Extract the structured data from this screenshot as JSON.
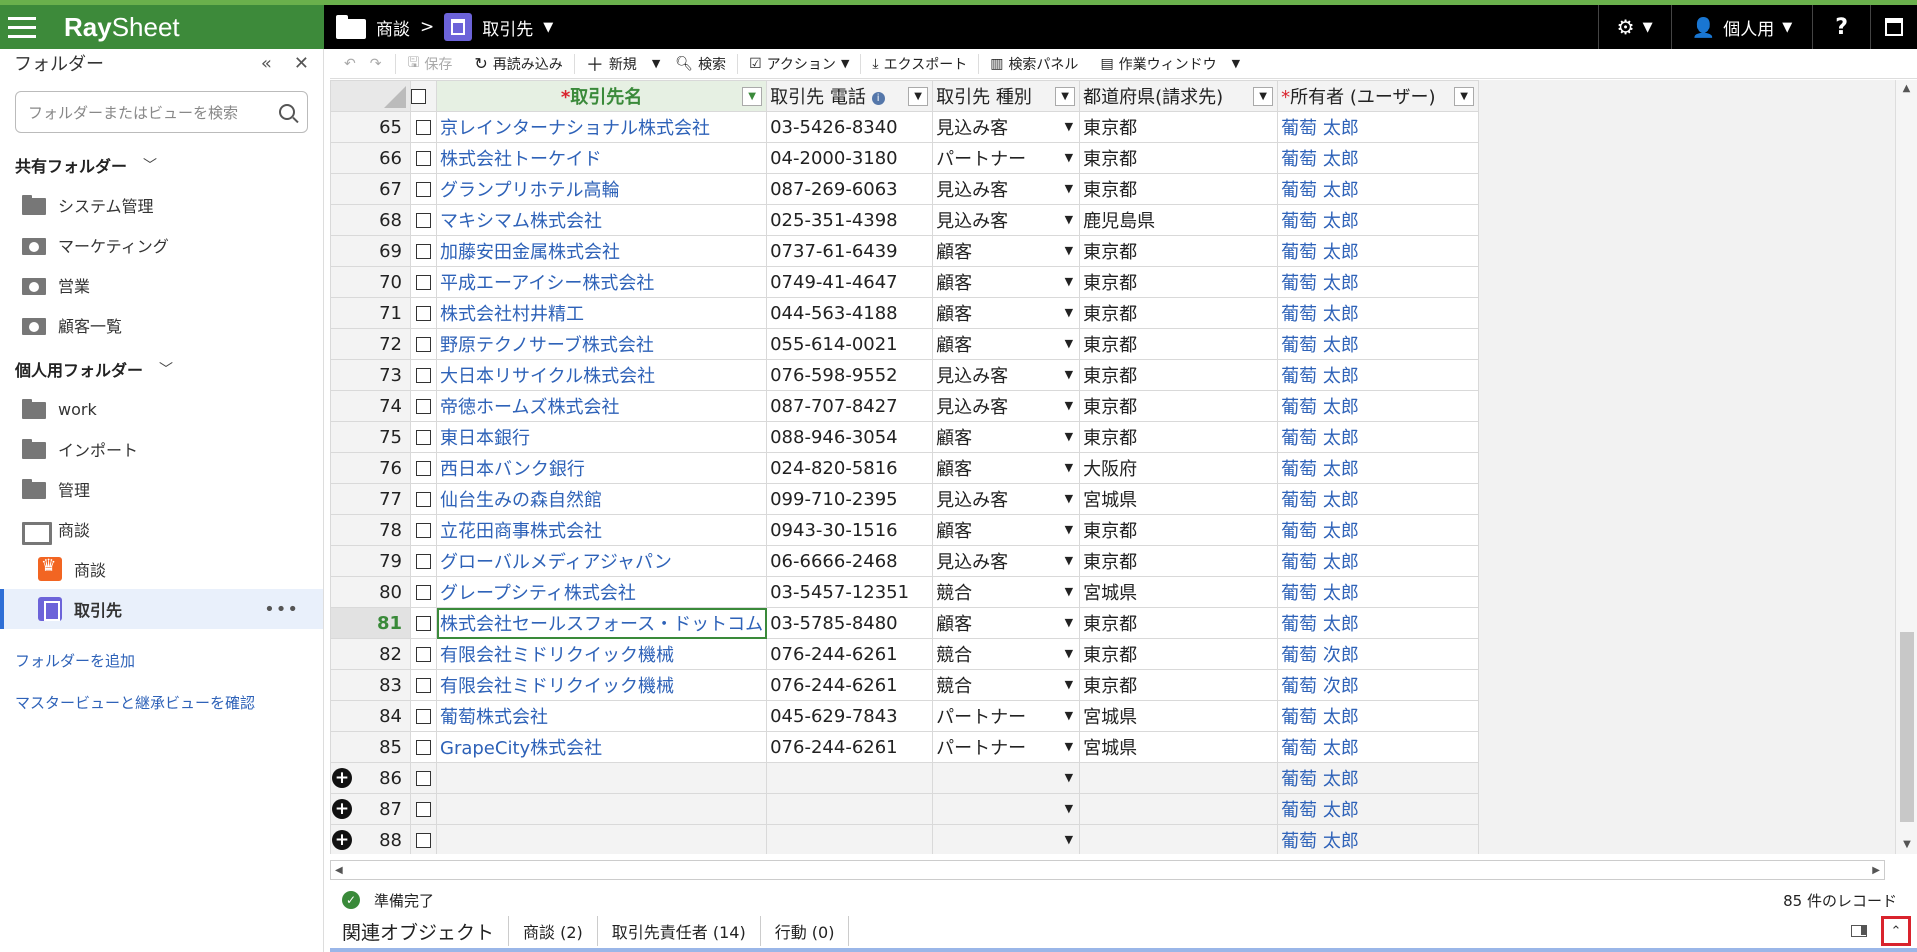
{
  "app": {
    "logo_ray": "Ray",
    "logo_sheet": "Sheet"
  },
  "topbar": {
    "crumb_folder": "商談",
    "crumb_sep": ">",
    "crumb_view": "取引先",
    "personal_label": "個人用",
    "help_label": "?"
  },
  "sidebar": {
    "title": "フォルダー",
    "search_placeholder": "フォルダーまたはビューを検索",
    "shared_title": "共有フォルダー",
    "shared_items": [
      "システム管理",
      "マーケティング",
      "営業",
      "顧客一覧"
    ],
    "personal_title": "個人用フォルダー",
    "personal_items": [
      "work",
      "インポート",
      "管理",
      "商談"
    ],
    "sub_items": [
      "商談",
      "取引先"
    ],
    "add_folder": "フォルダーを追加",
    "master_view": "マスタービューと継承ビューを確認"
  },
  "toolbar": {
    "save": "保存",
    "reload": "再読み込み",
    "new": "新規",
    "search": "検索",
    "action": "アクション",
    "export": "エクスポート",
    "search_panel": "検索パネル",
    "work_window": "作業ウィンドウ"
  },
  "grid": {
    "columns": [
      "取引先名",
      "取引先 電話",
      "取引先 種別",
      "都道府県(請求先)",
      "所有者 (ユーザー)"
    ],
    "required_mark": "*",
    "rows": [
      {
        "n": "65",
        "name": "京レインターナショナル株式会社",
        "tel": "03-5426-8340",
        "type": "見込み客",
        "pref": "東京都",
        "owner": "葡萄 太郎"
      },
      {
        "n": "66",
        "name": "株式会社トーケイド",
        "tel": "04-2000-3180",
        "type": "パートナー",
        "pref": "東京都",
        "owner": "葡萄 太郎"
      },
      {
        "n": "67",
        "name": "グランプリホテル高輪",
        "tel": "087-269-6063",
        "type": "見込み客",
        "pref": "東京都",
        "owner": "葡萄 太郎"
      },
      {
        "n": "68",
        "name": "マキシマム株式会社",
        "tel": "025-351-4398",
        "type": "見込み客",
        "pref": "鹿児島県",
        "owner": "葡萄 太郎"
      },
      {
        "n": "69",
        "name": "加藤安田金属株式会社",
        "tel": "0737-61-6439",
        "type": "顧客",
        "pref": "東京都",
        "owner": "葡萄 太郎"
      },
      {
        "n": "70",
        "name": "平成エーアイシー株式会社",
        "tel": "0749-41-4647",
        "type": "顧客",
        "pref": "東京都",
        "owner": "葡萄 太郎"
      },
      {
        "n": "71",
        "name": "株式会社村井精工",
        "tel": "044-563-4188",
        "type": "顧客",
        "pref": "東京都",
        "owner": "葡萄 太郎"
      },
      {
        "n": "72",
        "name": "野原テクノサーブ株式会社",
        "tel": "055-614-0021",
        "type": "顧客",
        "pref": "東京都",
        "owner": "葡萄 太郎"
      },
      {
        "n": "73",
        "name": "大日本リサイクル株式会社",
        "tel": "076-598-9552",
        "type": "見込み客",
        "pref": "東京都",
        "owner": "葡萄 太郎"
      },
      {
        "n": "74",
        "name": "帝徳ホームズ株式会社",
        "tel": "087-707-8427",
        "type": "見込み客",
        "pref": "東京都",
        "owner": "葡萄 太郎"
      },
      {
        "n": "75",
        "name": "東日本銀行",
        "tel": "088-946-3054",
        "type": "顧客",
        "pref": "東京都",
        "owner": "葡萄 太郎"
      },
      {
        "n": "76",
        "name": "西日本バンク銀行",
        "tel": "024-820-5816",
        "type": "顧客",
        "pref": "大阪府",
        "owner": "葡萄 太郎"
      },
      {
        "n": "77",
        "name": "仙台生みの森自然館",
        "tel": "099-710-2395",
        "type": "見込み客",
        "pref": "宮城県",
        "owner": "葡萄 太郎"
      },
      {
        "n": "78",
        "name": "立花田商事株式会社",
        "tel": "0943-30-1516",
        "type": "顧客",
        "pref": "東京都",
        "owner": "葡萄 太郎"
      },
      {
        "n": "79",
        "name": "グローバルメディアジャパン",
        "tel": "06-6666-2468",
        "type": "見込み客",
        "pref": "東京都",
        "owner": "葡萄 太郎"
      },
      {
        "n": "80",
        "name": "グレープシティ株式会社",
        "tel": "03-5457-12351",
        "type": "競合",
        "pref": "宮城県",
        "owner": "葡萄 太郎"
      },
      {
        "n": "81",
        "name": "株式会社セールスフォース・ドットコム",
        "tel": "03-5785-8480",
        "type": "顧客",
        "pref": "東京都",
        "owner": "葡萄 太郎"
      },
      {
        "n": "82",
        "name": "有限会社ミドリクイック機械",
        "tel": "076-244-6261",
        "type": "競合",
        "pref": "東京都",
        "owner": "葡萄 次郎"
      },
      {
        "n": "83",
        "name": "有限会社ミドリクイック機械",
        "tel": "076-244-6261",
        "type": "競合",
        "pref": "東京都",
        "owner": "葡萄 次郎"
      },
      {
        "n": "84",
        "name": "葡萄株式会社",
        "tel": "045-629-7843",
        "type": "パートナー",
        "pref": "宮城県",
        "owner": "葡萄 太郎"
      },
      {
        "n": "85",
        "name": "GrapeCity株式会社",
        "tel": "076-244-6261",
        "type": "パートナー",
        "pref": "宮城県",
        "owner": "葡萄 太郎"
      }
    ],
    "new_rows": [
      {
        "n": "86",
        "owner": "葡萄 太郎"
      },
      {
        "n": "87",
        "owner": "葡萄 太郎"
      },
      {
        "n": "88",
        "owner": "葡萄 太郎"
      }
    ],
    "current_row": "81"
  },
  "status": {
    "text": "準備完了",
    "count": "85 件のレコード"
  },
  "related": {
    "title": "関連オブジェクト",
    "tabs": [
      "商談 (2)",
      "取引先責任者 (14)",
      "行動 (0)"
    ]
  },
  "colors": {
    "accent_green": "#3d8a3a",
    "link_blue": "#2e62b8",
    "required_red": "#d9232d",
    "view_purple": "#6c63d9"
  }
}
